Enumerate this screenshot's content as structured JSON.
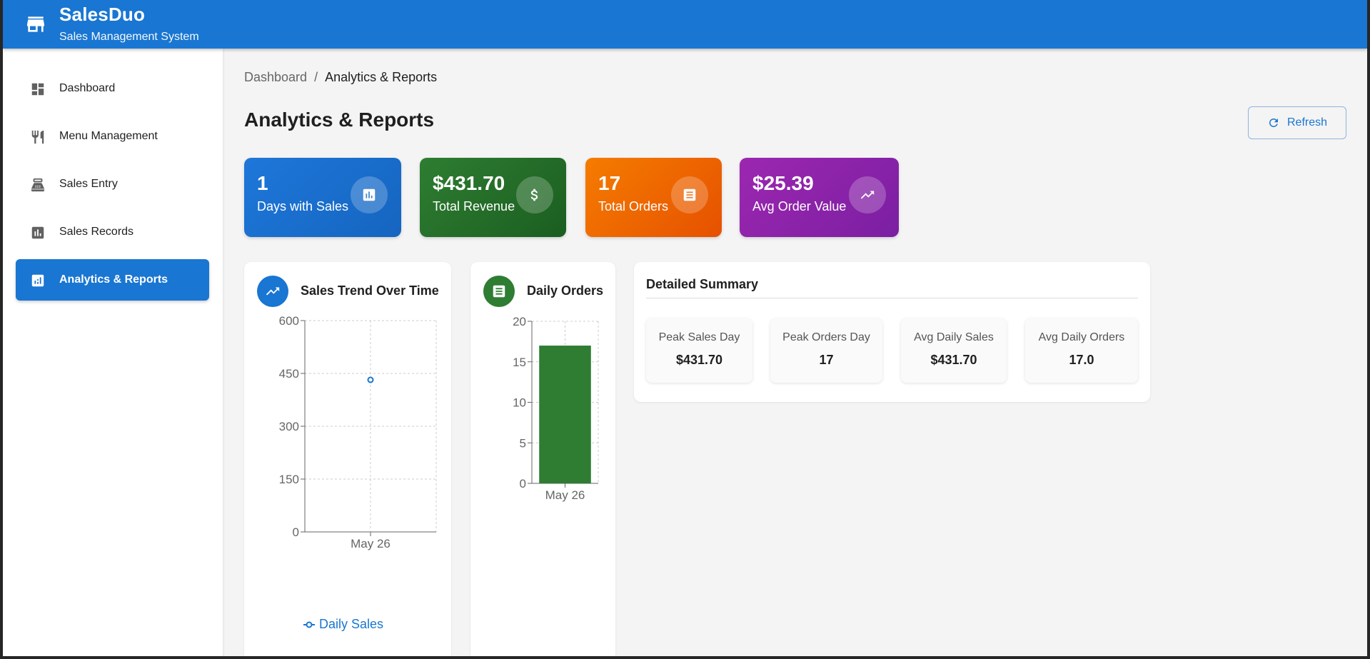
{
  "app": {
    "title": "SalesDuo",
    "subtitle": "Sales Management System"
  },
  "sidebar": {
    "items": [
      {
        "label": "Dashboard",
        "icon": "dashboard-icon",
        "active": false
      },
      {
        "label": "Menu Management",
        "icon": "restaurant-icon",
        "active": false
      },
      {
        "label": "Sales Entry",
        "icon": "point-of-sale-icon",
        "active": false
      },
      {
        "label": "Sales Records",
        "icon": "assessment-icon",
        "active": false
      },
      {
        "label": "Analytics & Reports",
        "icon": "analytics-icon",
        "active": true
      }
    ]
  },
  "breadcrumb": {
    "root": "Dashboard",
    "separator": "/",
    "current": "Analytics & Reports"
  },
  "page": {
    "title": "Analytics & Reports",
    "refresh_label": "Refresh"
  },
  "stats": [
    {
      "value": "1",
      "label": "Days with Sales",
      "icon": "assessment-icon",
      "color": "#1e77d9"
    },
    {
      "value": "$431.70",
      "label": "Total Revenue",
      "icon": "dollar-icon",
      "color": "#2a7d2e"
    },
    {
      "value": "17",
      "label": "Total Orders",
      "icon": "receipt-icon",
      "color": "#f26a0a"
    },
    {
      "value": "$25.39",
      "label": "Avg Order Value",
      "icon": "trending-up-icon",
      "color": "#9c27b0"
    }
  ],
  "panels": {
    "trend_title": "Sales Trend Over Time",
    "orders_title": "Daily Orders"
  },
  "summary": {
    "title": "Detailed Summary",
    "items": [
      {
        "label": "Peak Sales Day",
        "value": "$431.70"
      },
      {
        "label": "Peak Orders Day",
        "value": "17"
      },
      {
        "label": "Avg Daily Sales",
        "value": "$431.70"
      },
      {
        "label": "Avg Daily Orders",
        "value": "17.0"
      }
    ]
  },
  "chart_data": [
    {
      "type": "line",
      "x": [
        "May 26"
      ],
      "series": [
        {
          "name": "Daily Sales",
          "values": [
            431.7
          ]
        }
      ],
      "ylim": [
        0,
        600
      ],
      "yticks": [
        0,
        150,
        300,
        450,
        600
      ],
      "grid": true,
      "legend": "bottom",
      "color": "#1976d2"
    },
    {
      "type": "bar",
      "categories": [
        "May 26"
      ],
      "values": [
        17
      ],
      "ylim": [
        0,
        20
      ],
      "yticks": [
        0,
        5,
        10,
        15,
        20
      ],
      "grid": true,
      "color": "#2e7d32"
    }
  ]
}
